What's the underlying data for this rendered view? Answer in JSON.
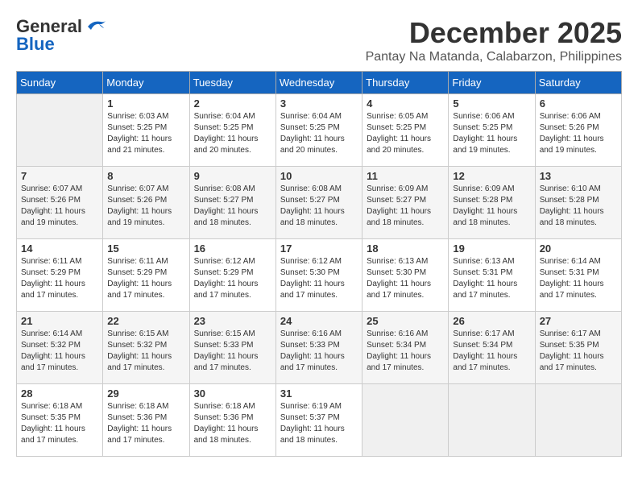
{
  "header": {
    "logo_line1": "General",
    "logo_line2": "Blue",
    "title": "December 2025",
    "subtitle": "Pantay Na Matanda, Calabarzon, Philippines"
  },
  "weekdays": [
    "Sunday",
    "Monday",
    "Tuesday",
    "Wednesday",
    "Thursday",
    "Friday",
    "Saturday"
  ],
  "weeks": [
    [
      {
        "day": "",
        "info": ""
      },
      {
        "day": "1",
        "info": "Sunrise: 6:03 AM\nSunset: 5:25 PM\nDaylight: 11 hours\nand 21 minutes."
      },
      {
        "day": "2",
        "info": "Sunrise: 6:04 AM\nSunset: 5:25 PM\nDaylight: 11 hours\nand 20 minutes."
      },
      {
        "day": "3",
        "info": "Sunrise: 6:04 AM\nSunset: 5:25 PM\nDaylight: 11 hours\nand 20 minutes."
      },
      {
        "day": "4",
        "info": "Sunrise: 6:05 AM\nSunset: 5:25 PM\nDaylight: 11 hours\nand 20 minutes."
      },
      {
        "day": "5",
        "info": "Sunrise: 6:06 AM\nSunset: 5:25 PM\nDaylight: 11 hours\nand 19 minutes."
      },
      {
        "day": "6",
        "info": "Sunrise: 6:06 AM\nSunset: 5:26 PM\nDaylight: 11 hours\nand 19 minutes."
      }
    ],
    [
      {
        "day": "7",
        "info": "Sunrise: 6:07 AM\nSunset: 5:26 PM\nDaylight: 11 hours\nand 19 minutes."
      },
      {
        "day": "8",
        "info": "Sunrise: 6:07 AM\nSunset: 5:26 PM\nDaylight: 11 hours\nand 19 minutes."
      },
      {
        "day": "9",
        "info": "Sunrise: 6:08 AM\nSunset: 5:27 PM\nDaylight: 11 hours\nand 18 minutes."
      },
      {
        "day": "10",
        "info": "Sunrise: 6:08 AM\nSunset: 5:27 PM\nDaylight: 11 hours\nand 18 minutes."
      },
      {
        "day": "11",
        "info": "Sunrise: 6:09 AM\nSunset: 5:27 PM\nDaylight: 11 hours\nand 18 minutes."
      },
      {
        "day": "12",
        "info": "Sunrise: 6:09 AM\nSunset: 5:28 PM\nDaylight: 11 hours\nand 18 minutes."
      },
      {
        "day": "13",
        "info": "Sunrise: 6:10 AM\nSunset: 5:28 PM\nDaylight: 11 hours\nand 18 minutes."
      }
    ],
    [
      {
        "day": "14",
        "info": "Sunrise: 6:11 AM\nSunset: 5:29 PM\nDaylight: 11 hours\nand 17 minutes."
      },
      {
        "day": "15",
        "info": "Sunrise: 6:11 AM\nSunset: 5:29 PM\nDaylight: 11 hours\nand 17 minutes."
      },
      {
        "day": "16",
        "info": "Sunrise: 6:12 AM\nSunset: 5:29 PM\nDaylight: 11 hours\nand 17 minutes."
      },
      {
        "day": "17",
        "info": "Sunrise: 6:12 AM\nSunset: 5:30 PM\nDaylight: 11 hours\nand 17 minutes."
      },
      {
        "day": "18",
        "info": "Sunrise: 6:13 AM\nSunset: 5:30 PM\nDaylight: 11 hours\nand 17 minutes."
      },
      {
        "day": "19",
        "info": "Sunrise: 6:13 AM\nSunset: 5:31 PM\nDaylight: 11 hours\nand 17 minutes."
      },
      {
        "day": "20",
        "info": "Sunrise: 6:14 AM\nSunset: 5:31 PM\nDaylight: 11 hours\nand 17 minutes."
      }
    ],
    [
      {
        "day": "21",
        "info": "Sunrise: 6:14 AM\nSunset: 5:32 PM\nDaylight: 11 hours\nand 17 minutes."
      },
      {
        "day": "22",
        "info": "Sunrise: 6:15 AM\nSunset: 5:32 PM\nDaylight: 11 hours\nand 17 minutes."
      },
      {
        "day": "23",
        "info": "Sunrise: 6:15 AM\nSunset: 5:33 PM\nDaylight: 11 hours\nand 17 minutes."
      },
      {
        "day": "24",
        "info": "Sunrise: 6:16 AM\nSunset: 5:33 PM\nDaylight: 11 hours\nand 17 minutes."
      },
      {
        "day": "25",
        "info": "Sunrise: 6:16 AM\nSunset: 5:34 PM\nDaylight: 11 hours\nand 17 minutes."
      },
      {
        "day": "26",
        "info": "Sunrise: 6:17 AM\nSunset: 5:34 PM\nDaylight: 11 hours\nand 17 minutes."
      },
      {
        "day": "27",
        "info": "Sunrise: 6:17 AM\nSunset: 5:35 PM\nDaylight: 11 hours\nand 17 minutes."
      }
    ],
    [
      {
        "day": "28",
        "info": "Sunrise: 6:18 AM\nSunset: 5:35 PM\nDaylight: 11 hours\nand 17 minutes."
      },
      {
        "day": "29",
        "info": "Sunrise: 6:18 AM\nSunset: 5:36 PM\nDaylight: 11 hours\nand 17 minutes."
      },
      {
        "day": "30",
        "info": "Sunrise: 6:18 AM\nSunset: 5:36 PM\nDaylight: 11 hours\nand 18 minutes."
      },
      {
        "day": "31",
        "info": "Sunrise: 6:19 AM\nSunset: 5:37 PM\nDaylight: 11 hours\nand 18 minutes."
      },
      {
        "day": "",
        "info": ""
      },
      {
        "day": "",
        "info": ""
      },
      {
        "day": "",
        "info": ""
      }
    ]
  ]
}
